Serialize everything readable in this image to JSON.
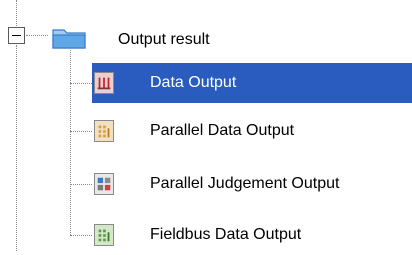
{
  "tree": {
    "root": {
      "label": "Output result",
      "expanded": true,
      "icon": "folder-icon"
    },
    "children": [
      {
        "label": "Data Output",
        "icon": "data-output-icon",
        "selected": true
      },
      {
        "label": "Parallel Data Output",
        "icon": "parallel-data-output-icon",
        "selected": false
      },
      {
        "label": "Parallel Judgement Output",
        "icon": "parallel-judgement-output-icon",
        "selected": false
      },
      {
        "label": "Fieldbus Data Output",
        "icon": "fieldbus-data-output-icon",
        "selected": false
      }
    ]
  },
  "colors": {
    "selection": "#2a5cc0",
    "selected_text": "#ffffff",
    "tree_lines": "#8a8a8a",
    "folder": "#5fa8e8"
  }
}
